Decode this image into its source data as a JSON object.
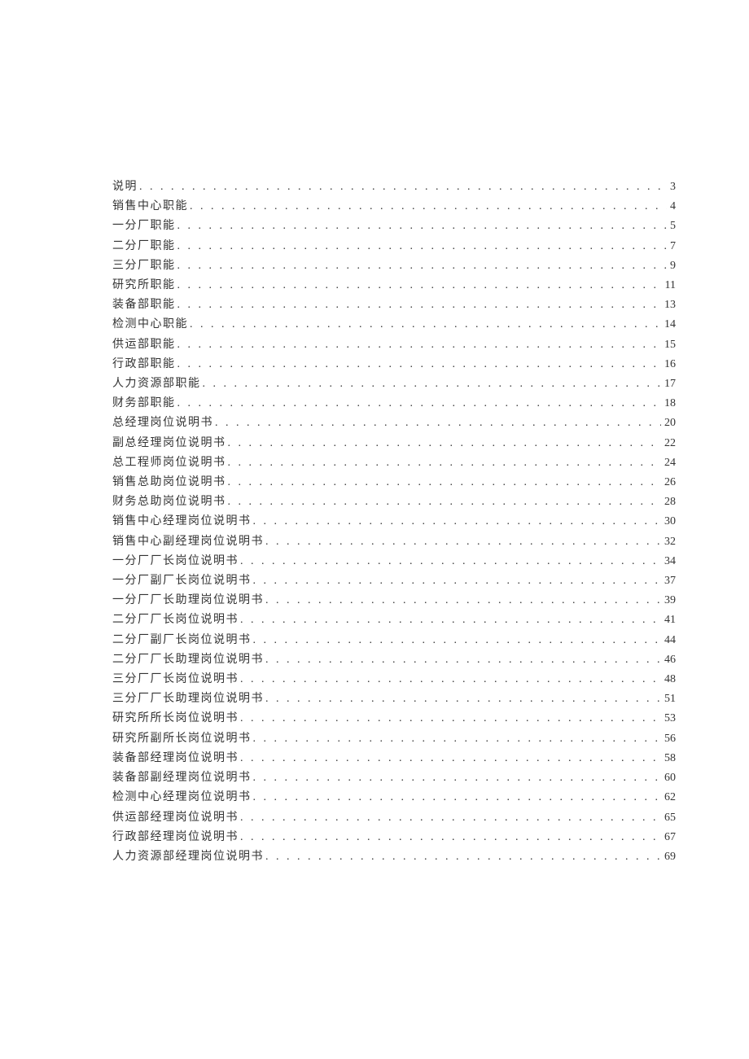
{
  "toc": [
    {
      "title": "说明",
      "page": "3"
    },
    {
      "title": "销售中心职能",
      "page": "4"
    },
    {
      "title": "一分厂职能",
      "page": "5"
    },
    {
      "title": "二分厂职能",
      "page": "7"
    },
    {
      "title": "三分厂职能",
      "page": "9"
    },
    {
      "title": "研究所职能",
      "page": "11"
    },
    {
      "title": "装备部职能",
      "page": "13"
    },
    {
      "title": "检测中心职能",
      "page": "14"
    },
    {
      "title": "供运部职能",
      "page": "15"
    },
    {
      "title": "行政部职能",
      "page": "16"
    },
    {
      "title": "人力资源部职能",
      "page": "17"
    },
    {
      "title": "财务部职能",
      "page": "18"
    },
    {
      "title": "总经理岗位说明书",
      "page": "20"
    },
    {
      "title": "副总经理岗位说明书",
      "page": "22"
    },
    {
      "title": "总工程师岗位说明书",
      "page": "24"
    },
    {
      "title": "销售总助岗位说明书",
      "page": "26"
    },
    {
      "title": "财务总助岗位说明书",
      "page": "28"
    },
    {
      "title": "销售中心经理岗位说明书",
      "page": "30"
    },
    {
      "title": "销售中心副经理岗位说明书",
      "page": "32"
    },
    {
      "title": "一分厂厂长岗位说明书",
      "page": "34"
    },
    {
      "title": "一分厂副厂长岗位说明书",
      "page": "37"
    },
    {
      "title": "一分厂厂长助理岗位说明书",
      "page": "39"
    },
    {
      "title": "二分厂厂长岗位说明书",
      "page": "41"
    },
    {
      "title": "二分厂副厂长岗位说明书",
      "page": "44"
    },
    {
      "title": "二分厂厂长助理岗位说明书",
      "page": "46"
    },
    {
      "title": "三分厂厂长岗位说明书",
      "page": "48"
    },
    {
      "title": "三分厂厂长助理岗位说明书",
      "page": "51"
    },
    {
      "title": "研究所所长岗位说明书",
      "page": "53"
    },
    {
      "title": "研究所副所长岗位说明书",
      "page": "56"
    },
    {
      "title": "装备部经理岗位说明书",
      "page": "58"
    },
    {
      "title": "装备部副经理岗位说明书",
      "page": "60"
    },
    {
      "title": "检测中心经理岗位说明书",
      "page": "62"
    },
    {
      "title": "供运部经理岗位说明书",
      "page": "65"
    },
    {
      "title": "行政部经理岗位说明书",
      "page": "67"
    },
    {
      "title": "人力资源部经理岗位说明书",
      "page": "69"
    }
  ]
}
